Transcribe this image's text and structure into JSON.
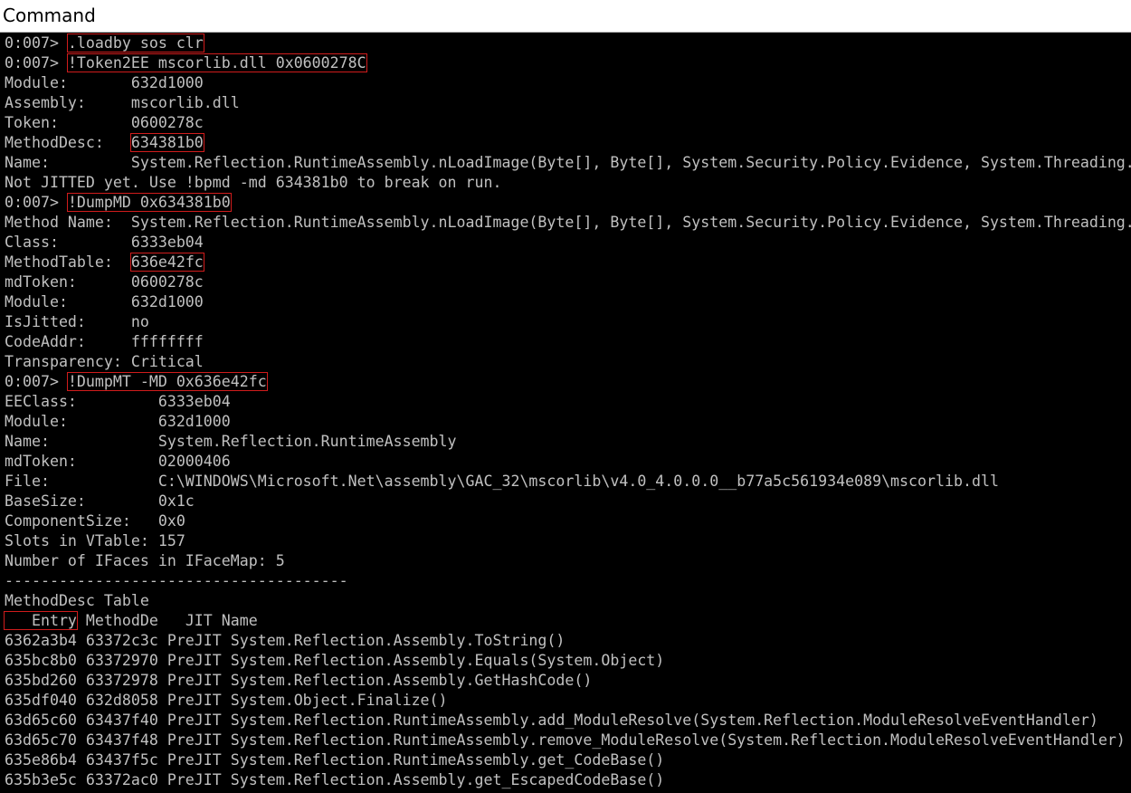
{
  "window": {
    "title": "Command"
  },
  "colors": {
    "background": "#000000",
    "text": "#c0c0c0",
    "highlight_border": "#d01c1c"
  },
  "lines": [
    {
      "text": "0:007> ",
      "hl": ".loadby sos clr"
    },
    {
      "text": "0:007> ",
      "hl": "!Token2EE mscorlib.dll 0x0600278C"
    },
    {
      "text": "Module:       632d1000"
    },
    {
      "text": "Assembly:     mscorlib.dll"
    },
    {
      "text": "Token:        0600278c"
    },
    {
      "text": "MethodDesc:   ",
      "hl": "634381b0"
    },
    {
      "text": "Name:         System.Reflection.RuntimeAssembly.nLoadImage(Byte[], Byte[], System.Security.Policy.Evidence, System.Threading.StackCrawlMark ByRef, Boolean, System.Security.SecurityContextSource)"
    },
    {
      "text": "Not JITTED yet. Use !bpmd -md 634381b0 to break on run."
    },
    {
      "text": "0:007> ",
      "hl": "!DumpMD 0x634381b0"
    },
    {
      "text": "Method Name:  System.Reflection.RuntimeAssembly.nLoadImage(Byte[], Byte[], System.Security.Policy.Evidence, System.Threading.StackCrawlMark ByRef, Boolean, System.Security.SecurityContextSource)"
    },
    {
      "text": "Class:        6333eb04"
    },
    {
      "text": "MethodTable:  ",
      "hl": "636e42fc"
    },
    {
      "text": "mdToken:      0600278c"
    },
    {
      "text": "Module:       632d1000"
    },
    {
      "text": "IsJitted:     no"
    },
    {
      "text": "CodeAddr:     ffffffff"
    },
    {
      "text": "Transparency: Critical"
    },
    {
      "text": "0:007> ",
      "hl": "!DumpMT -MD 0x636e42fc"
    },
    {
      "text": "EEClass:         6333eb04"
    },
    {
      "text": "Module:          632d1000"
    },
    {
      "text": "Name:            System.Reflection.RuntimeAssembly"
    },
    {
      "text": "mdToken:         02000406"
    },
    {
      "text": "File:            C:\\WINDOWS\\Microsoft.Net\\assembly\\GAC_32\\mscorlib\\v4.0_4.0.0.0__b77a5c561934e089\\mscorlib.dll"
    },
    {
      "text": "BaseSize:        0x1c"
    },
    {
      "text": "ComponentSize:   0x0"
    },
    {
      "text": "Slots in VTable: 157"
    },
    {
      "text": "Number of IFaces in IFaceMap: 5"
    },
    {
      "text": "--------------------------------------"
    },
    {
      "text": "MethodDesc Table"
    },
    {
      "text": "",
      "hl": "   Entry",
      "rest": " MethodDe   JIT Name"
    },
    {
      "text": "6362a3b4 63372c3c PreJIT System.Reflection.Assembly.ToString()"
    },
    {
      "text": "635bc8b0 63372970 PreJIT System.Reflection.Assembly.Equals(System.Object)"
    },
    {
      "text": "635bd260 63372978 PreJIT System.Reflection.Assembly.GetHashCode()"
    },
    {
      "text": "635df040 632d8058 PreJIT System.Object.Finalize()"
    },
    {
      "text": "63d65c60 63437f40 PreJIT System.Reflection.RuntimeAssembly.add_ModuleResolve(System.Reflection.ModuleResolveEventHandler)"
    },
    {
      "text": "63d65c70 63437f48 PreJIT System.Reflection.RuntimeAssembly.remove_ModuleResolve(System.Reflection.ModuleResolveEventHandler)"
    },
    {
      "text": "635e86b4 63437f5c PreJIT System.Reflection.RuntimeAssembly.get_CodeBase()"
    },
    {
      "text": "635b3e5c 63372ac0 PreJIT System.Reflection.Assembly.get_EscapedCodeBase()"
    }
  ]
}
